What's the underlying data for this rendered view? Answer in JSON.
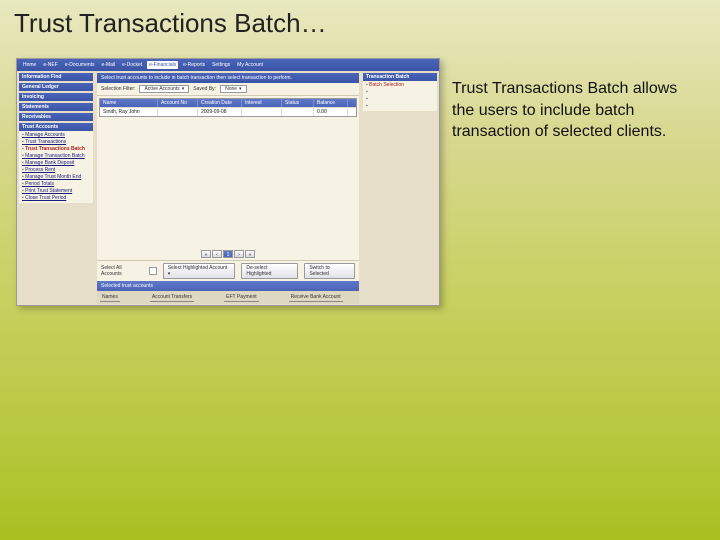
{
  "slide": {
    "title": "Trust Transactions Batch…",
    "description": "Trust Transactions Batch allows the users to include batch transaction of selected clients."
  },
  "topnav": {
    "items": [
      "Home",
      "e-NEF",
      "e-Documents",
      "e-Mail",
      "e-Docket",
      "e-Financials",
      "e-Reports",
      "Settings",
      "My Account"
    ],
    "active_index": 5
  },
  "left": {
    "panels": [
      {
        "title": "Information Find",
        "links": []
      },
      {
        "title": "General Ledger",
        "links": []
      },
      {
        "title": "Invoicing",
        "links": []
      },
      {
        "title": "Statements",
        "links": []
      },
      {
        "title": "Receivables",
        "links": []
      }
    ],
    "trust_panel": {
      "title": "Trust Accounts",
      "links": [
        "Manage Accounts",
        "Trust Transactions",
        "Trust Transactions Batch",
        "Manage Transaction Batch",
        "Manage Bank Deposit",
        "Process Rent",
        "Manage Trust Month End",
        "Period Totals",
        "Print Trust Statement",
        "Close Trust Period"
      ],
      "highlight_index": 2
    }
  },
  "center": {
    "instruction": "Select trust accounts to include in batch transaction then select transaction to perform.",
    "filter": {
      "label": "Selection Filter:",
      "accounts": "Active Accounts",
      "savedby_label": "Saved By:",
      "savedby": "None"
    },
    "grid": {
      "headers": [
        "Name",
        "Account No",
        "Creation Date",
        "Interest",
        "Status",
        "Balance"
      ],
      "rows": [
        [
          "Smith, Ray John",
          "",
          "2009-09-08",
          "",
          "",
          "0.00"
        ]
      ]
    },
    "pager": {
      "buttons": [
        "«",
        "‹",
        "1",
        "›",
        "»"
      ]
    },
    "selection_bar": {
      "all_label": "Select All Accounts",
      "highlight_label": "Select Highlighted Account",
      "deselect_label": "De-select Highlighted",
      "switch_label": "Switch to Selected"
    },
    "selected_header": "Selected trust accounts",
    "bottom_tabs": [
      "Names",
      "Account Transfers",
      "EFT Payment",
      "Receive Bank Account"
    ]
  },
  "right": {
    "panel_title": "Transaction Batch",
    "links": [
      "Batch Selection",
      "",
      "",
      ""
    ]
  }
}
